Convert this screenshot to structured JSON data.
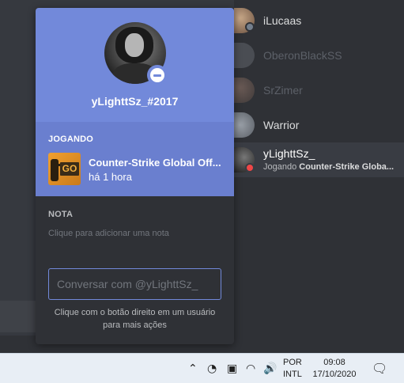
{
  "popout": {
    "username": "yLighttSz_#2017",
    "activity_title": "JOGANDO",
    "game_name": "Counter-Strike Global Off...",
    "game_elapsed": "há 1 hora",
    "game_icon_text": "GO",
    "note_title": "NOTA",
    "note_placeholder": "Clique para adicionar uma nota",
    "message_placeholder": "Conversar com @yLighttSz_",
    "tip_line1": "Clique com o botão direito em um usuário",
    "tip_line2": "para mais ações"
  },
  "members": [
    {
      "name": "iLucaas",
      "status_color": "#747f8d",
      "name_color": "#dcddde"
    },
    {
      "name": "OberonBlackSS",
      "status_color": "#747f8d",
      "name_color": "#5c6068"
    },
    {
      "name": "SrZimer",
      "status_color": "#747f8d",
      "name_color": "#5c6068"
    },
    {
      "name": "Warrior",
      "status_color": "#747f8d",
      "name_color": "#dcddde"
    },
    {
      "name": "yLighttSz_",
      "status_color": "#f04747",
      "name_color": "#ffffff",
      "activity_prefix": "Jogando",
      "activity_game": "Counter-Strike Globa..."
    }
  ],
  "taskbar": {
    "lang_line1": "POR",
    "lang_line2": "INTL",
    "time": "09:08",
    "date": "17/10/2020"
  },
  "colors": {
    "blurple": "#7289da",
    "dnd_red": "#f04747",
    "background": "#36393f"
  }
}
